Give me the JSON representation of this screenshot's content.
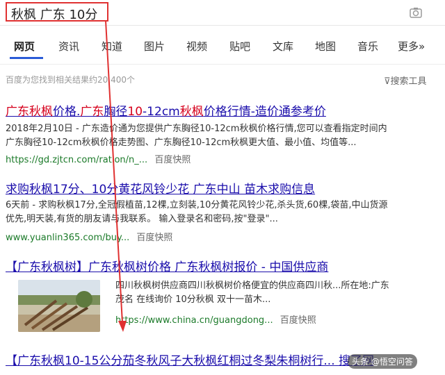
{
  "search": {
    "query": "秋枫 广东 10分"
  },
  "tabs": [
    {
      "label": "网页"
    },
    {
      "label": "资讯"
    },
    {
      "label": "知道"
    },
    {
      "label": "图片"
    },
    {
      "label": "视频"
    },
    {
      "label": "贴吧"
    },
    {
      "label": "文库"
    },
    {
      "label": "地图"
    },
    {
      "label": "音乐"
    },
    {
      "label": "更多»"
    }
  ],
  "stats": "百度为您找到相关结果约20,400个",
  "tools": "搜索工具",
  "results": [
    {
      "title_parts": [
        "广东秋枫",
        "价格.",
        "广东",
        "胸径",
        "10",
        "-12cm",
        "秋枫",
        "价格行情-造价通参考价"
      ],
      "snippet1": "2018年2月10日 - 广东造价通为您提供广东胸径10-12cm秋枫价格行情,您可以查看指定时间内",
      "snippet2": "广东胸径10-12cm秋枫价格走势图、广东胸径10-12cm秋枫更大值、最小值、均值等...",
      "url": "https://gd.zjtcn.com/ration/n_...",
      "snap": "百度快照"
    },
    {
      "title": "求购秋枫17分、10分黄花风铃少花 广东中山 苗木求购信息",
      "snippet1": "6天前 - 求购秋枫17分,全冠假植苗,12棵,立刻装,10分黄花风铃少花,杀头货,60棵,袋苗,中山货源",
      "snippet2": "优先,明天装,有货的朋友请与我联系。 输入登录名和密码,按\"登录\"...",
      "url": "www.yuanlin365.com/buy...",
      "snap": "百度快照"
    },
    {
      "title": "【广东秋枫树】广东秋枫树价格 广东秋枫树报价 - 中国供应商",
      "snippet1": "四川秋枫树供应商四川秋枫树价格便宜的供应商四川秋...所在地:广东",
      "snippet2": "茂名 在线询价 10分秋枫 双十一苗木...",
      "url": "https://www.china.cn/guangdong...",
      "snap": "百度快照"
    },
    {
      "title": "【广东秋枫10-15公分茄冬秋风子大秋枫红桐过冬梨朱桐树行...",
      "tail": "搜了网"
    }
  ],
  "watermark": "头条 @悟空问答",
  "colors": {
    "title": "#1a0dab",
    "highlight": "#d6001c",
    "url": "#1b7a29",
    "annotation": "#e03131",
    "tab_active": "#2a5bd7"
  }
}
